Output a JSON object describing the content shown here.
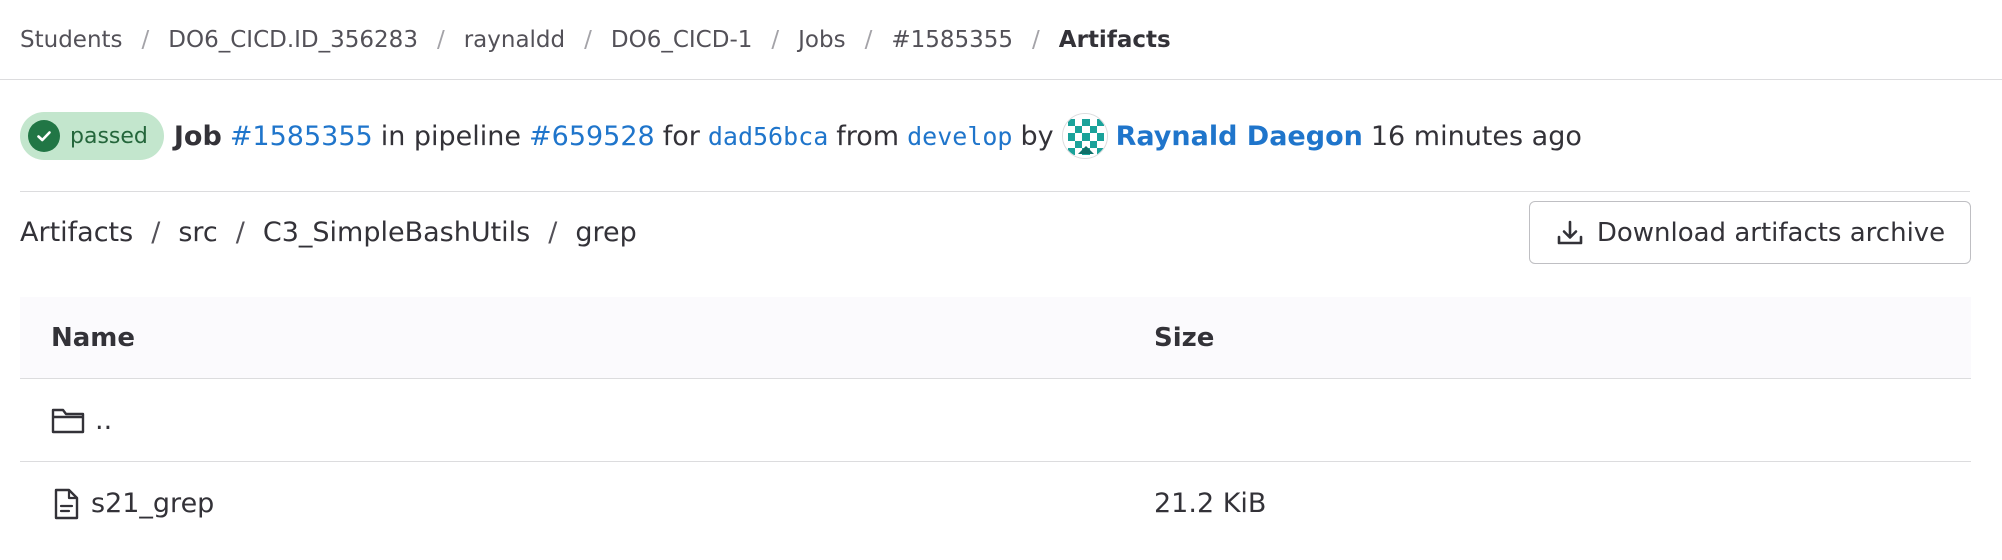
{
  "breadcrumb": {
    "items": [
      "Students",
      "DO6_CICD.ID_356283",
      "raynaldd",
      "DO6_CICD-1",
      "Jobs",
      "#1585355"
    ],
    "current": "Artifacts",
    "separator": "/"
  },
  "job": {
    "status": "passed",
    "status_color": "#217645",
    "label": "Job",
    "job_id": "#1585355",
    "in_pipeline": "in pipeline",
    "pipeline_id": "#659528",
    "for_text": "for",
    "commit": "dad56bca",
    "from_text": "from",
    "branch": "develop",
    "by_text": "by",
    "user": "Raynald Daegon",
    "time_ago": "16 minutes ago",
    "link_color": "#1f75cb"
  },
  "path": {
    "segments": [
      "Artifacts",
      "src",
      "C3_SimpleBashUtils",
      "grep"
    ],
    "separator": "/"
  },
  "download_button": {
    "label": "Download artifacts archive",
    "icon": "download-icon"
  },
  "table": {
    "headers": {
      "name": "Name",
      "size": "Size"
    },
    "rows": [
      {
        "name": "..",
        "size": "",
        "icon": "folder-icon"
      },
      {
        "name": "s21_grep",
        "size": "21.2 KiB",
        "icon": "file-icon"
      }
    ]
  }
}
